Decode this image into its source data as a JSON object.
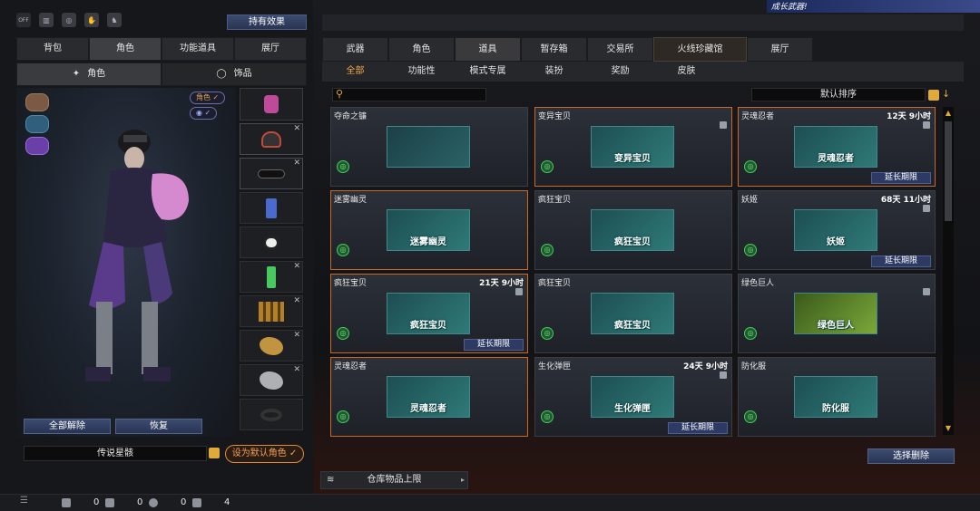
{
  "left": {
    "effect_button": "持有效果",
    "tabs": [
      "背包",
      "角色",
      "功能道具",
      "展厅"
    ],
    "active_tab": 1,
    "sub_tabs": [
      "角色",
      "饰品"
    ],
    "role_tag": "角色 ✓",
    "eye_tag": "✓",
    "clear_all": "全部解除",
    "restore": "恢复",
    "character_name": "传说星骸",
    "set_default": "设为默认角色 ✓"
  },
  "right": {
    "main_tabs": [
      "武器",
      "角色",
      "道具",
      "暂存箱",
      "交易所",
      "火线珍藏馆",
      "展厅"
    ],
    "active_main_tab": 2,
    "categories": [
      "全部",
      "功能性",
      "模式专属",
      "装扮",
      "奖励",
      "皮肤"
    ],
    "active_category": 0,
    "sort_label": "默认排序",
    "extend_label": "延长期限",
    "select_delete": "选择删除",
    "storage_limit": "仓库物品上限",
    "items": [
      {
        "name": "夺命之镰",
        "time": "",
        "thumb_label": "",
        "orange": false,
        "lock": false,
        "extend": false
      },
      {
        "name": "变异宝贝",
        "time": "",
        "thumb_label": "变异宝贝",
        "orange": true,
        "lock": true,
        "extend": false
      },
      {
        "name": "灵魂忍者",
        "time": "12天 9小时",
        "thumb_label": "灵魂忍者",
        "orange": true,
        "lock": true,
        "extend": true
      },
      {
        "name": "迷雾幽灵",
        "time": "",
        "thumb_label": "迷雾幽灵",
        "orange": true,
        "lock": false,
        "extend": false
      },
      {
        "name": "疯狂宝贝",
        "time": "",
        "thumb_label": "疯狂宝贝",
        "orange": false,
        "lock": false,
        "extend": false
      },
      {
        "name": "妖姬",
        "time": "68天 11小时",
        "thumb_label": "妖姬",
        "orange": false,
        "lock": true,
        "extend": true
      },
      {
        "name": "疯狂宝贝",
        "time": "21天 9小时",
        "thumb_label": "疯狂宝贝",
        "orange": true,
        "lock": true,
        "extend": true
      },
      {
        "name": "疯狂宝贝",
        "time": "",
        "thumb_label": "疯狂宝贝",
        "orange": false,
        "lock": false,
        "extend": false
      },
      {
        "name": "绿色巨人",
        "time": "",
        "thumb_label": "绿色巨人",
        "orange": false,
        "lock": true,
        "extend": false
      },
      {
        "name": "灵魂忍者",
        "time": "",
        "thumb_label": "灵魂忍者",
        "orange": true,
        "lock": false,
        "extend": false
      },
      {
        "name": "生化弹匣",
        "time": "24天 9小时",
        "thumb_label": "生化弹匣",
        "orange": false,
        "lock": true,
        "extend": true
      },
      {
        "name": "防化服",
        "time": "",
        "thumb_label": "防化服",
        "orange": false,
        "lock": false,
        "extend": false
      }
    ]
  },
  "status": {
    "count1": "0",
    "count2": "0",
    "count3": "0",
    "count4": "4"
  },
  "banner_text": "成长武器!",
  "colors": {
    "accent": "#f2a84a",
    "border_orange": "#c8692a",
    "button_blue": "#2c3a64"
  }
}
